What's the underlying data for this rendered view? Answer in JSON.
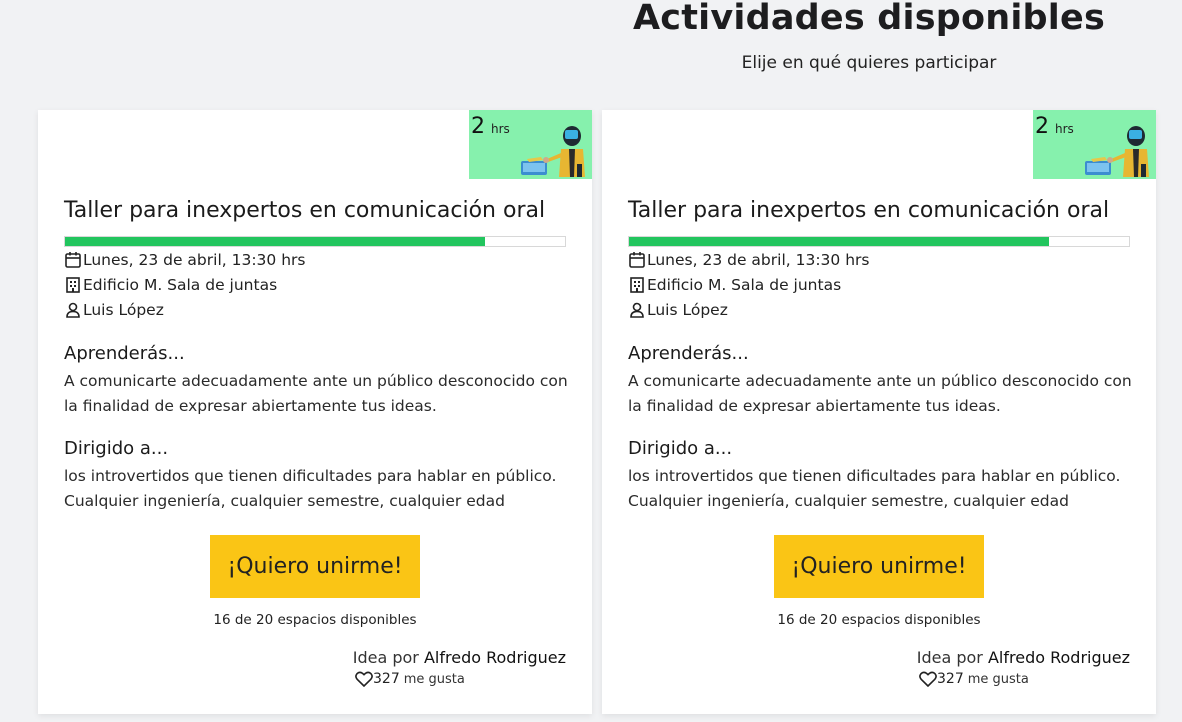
{
  "page": {
    "title": "Actividades disponibles",
    "subtitle": "Elije en qué quieres participar"
  },
  "colors": {
    "background": "#f1f2f4",
    "card": "#ffffff",
    "badge": "#86f1ad",
    "progress": "#22c55e",
    "button": "#fac515"
  },
  "cards": [
    {
      "duration_value": "2",
      "duration_unit": "hrs",
      "illustration_icon": "robot-presenter-icon",
      "title": "Taller para inexpertos en comunicación oral",
      "capacity_progress": 0.84,
      "date": "Lunes, 23 de abril, 13:30 hrs",
      "date_icon": "calendar-icon",
      "location": "Edificio M. Sala de juntas",
      "location_icon": "building-icon",
      "instructor": "Luis López",
      "instructor_icon": "user-icon",
      "learn_heading": "Aprenderás...",
      "learn_text": "A comunicarte adecuadamente ante un público desconocido con la finalidad de expresar abiertamente tus ideas.",
      "audience_heading": "Dirigido a...",
      "audience_text": "los introvertidos que tienen dificultades para hablar en público. Cualquier ingeniería, cualquier semestre, cualquier edad",
      "join_label": "¡Quiero unirme!",
      "spaces": "16 de 20 espacios disponibles",
      "idea_prefix": "Idea por",
      "idea_author": "Alfredo Rodriguez",
      "likes_count": "327",
      "likes_label": "me gusta",
      "likes_icon": "heart-icon"
    },
    {
      "duration_value": "2",
      "duration_unit": "hrs",
      "illustration_icon": "robot-presenter-icon",
      "title": "Taller para inexpertos en comunicación oral",
      "capacity_progress": 0.84,
      "date": "Lunes, 23 de abril, 13:30 hrs",
      "date_icon": "calendar-icon",
      "location": "Edificio M. Sala de juntas",
      "location_icon": "building-icon",
      "instructor": "Luis López",
      "instructor_icon": "user-icon",
      "learn_heading": "Aprenderás...",
      "learn_text": "A comunicarte adecuadamente ante un público desconocido con la finalidad de expresar abiertamente tus ideas.",
      "audience_heading": "Dirigido a...",
      "audience_text": "los introvertidos que tienen dificultades para hablar en público. Cualquier ingeniería, cualquier semestre, cualquier edad",
      "join_label": "¡Quiero unirme!",
      "spaces": "16 de 20 espacios disponibles",
      "idea_prefix": "Idea por",
      "idea_author": "Alfredo Rodriguez",
      "likes_count": "327",
      "likes_label": "me gusta",
      "likes_icon": "heart-icon"
    }
  ]
}
